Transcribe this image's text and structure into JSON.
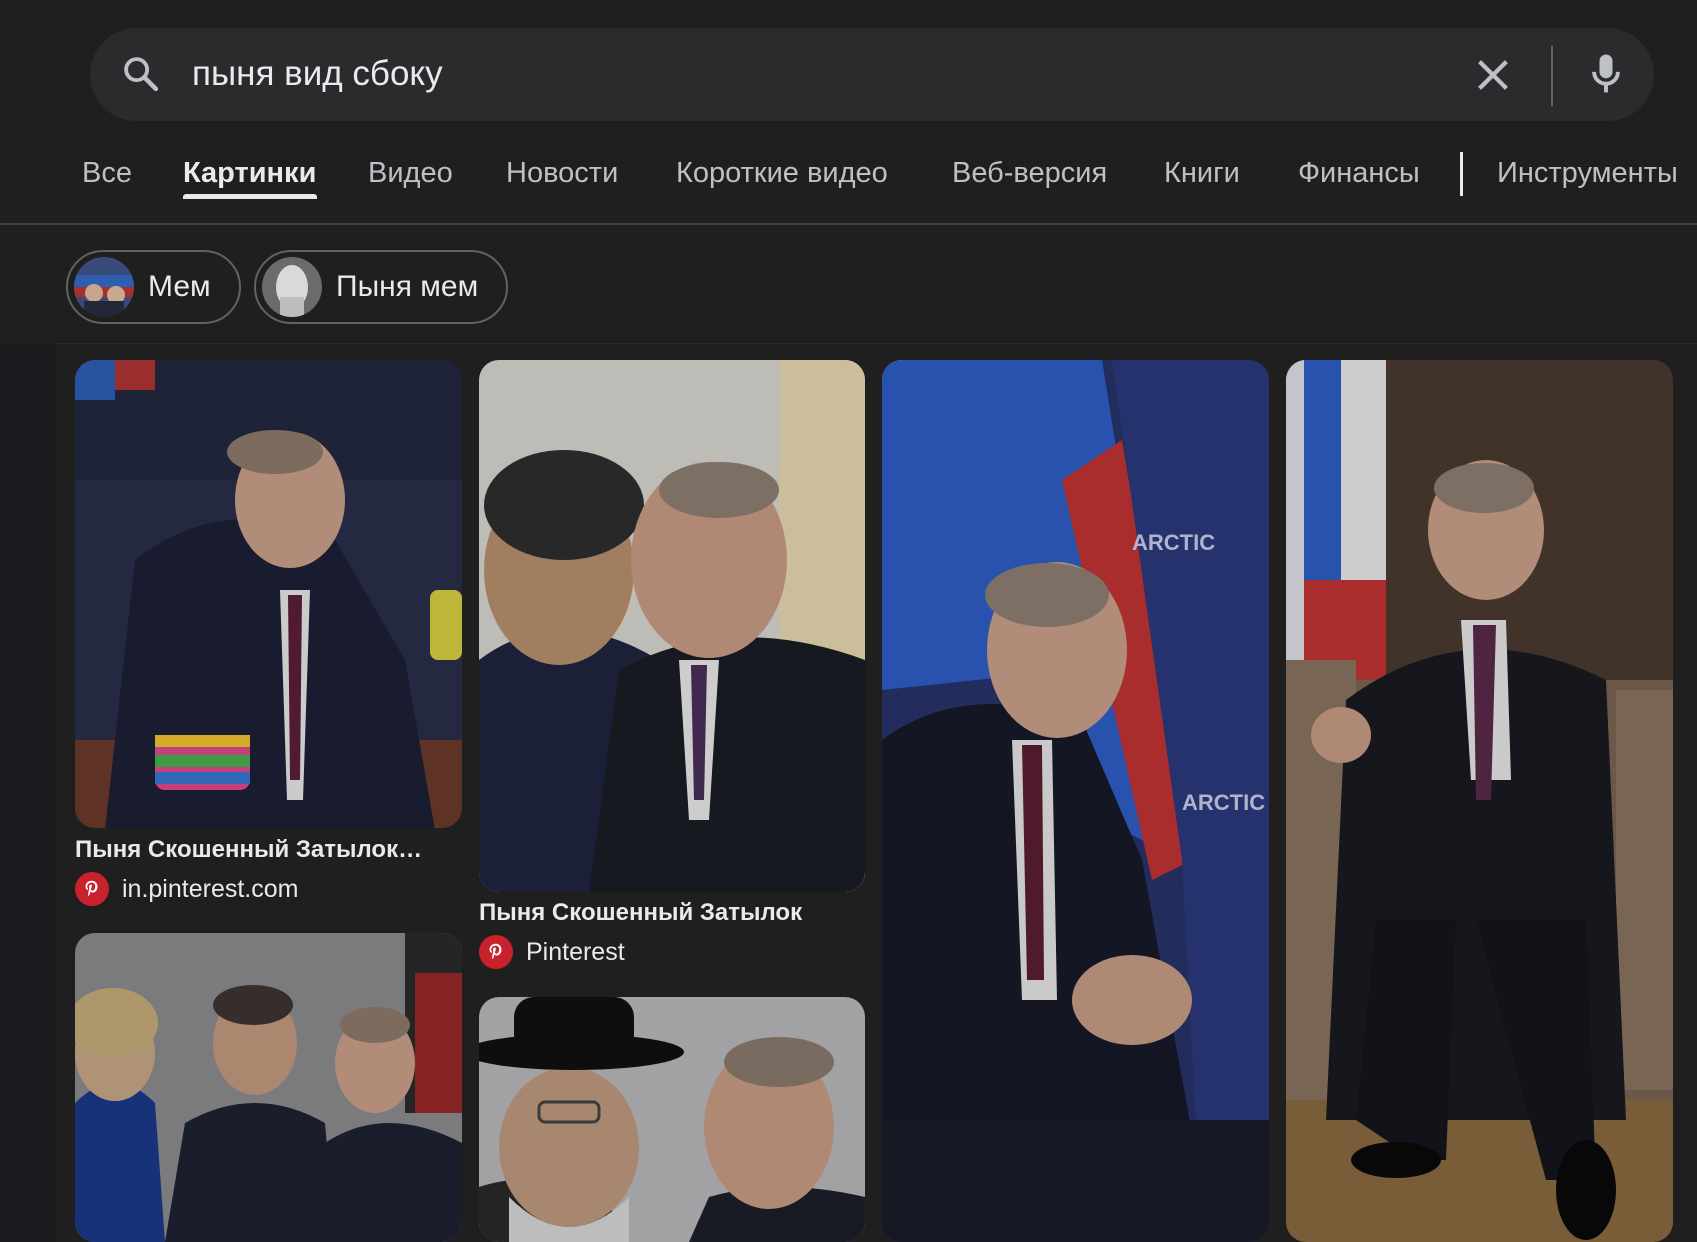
{
  "search": {
    "query": "пыня вид сбоку"
  },
  "tabs": [
    {
      "label": "Все",
      "active": false
    },
    {
      "label": "Картинки",
      "active": true
    },
    {
      "label": "Видео",
      "active": false
    },
    {
      "label": "Новости",
      "active": false
    },
    {
      "label": "Короткие видео",
      "active": false
    },
    {
      "label": "Веб-версия",
      "active": false
    },
    {
      "label": "Книги",
      "active": false
    },
    {
      "label": "Финансы",
      "active": false
    },
    {
      "label": "Инструменты",
      "active": false
    }
  ],
  "chips": [
    {
      "label": "Мем"
    },
    {
      "label": "Пыня мем"
    }
  ],
  "results": [
    {
      "title": "Пыня Скошенный Затылок…",
      "source": "in.pinterest.com",
      "source_icon": "pinterest-icon"
    },
    {
      "title": "Пыня Скошенный Затылок",
      "source": "Pinterest",
      "source_icon": "pinterest-icon"
    }
  ],
  "colors": {
    "background": "#1f1f1f",
    "searchbar": "#2b2b2d",
    "text": "#e8eaed",
    "muted_text": "#bdc1c6",
    "pinterest_red": "#c8232c"
  }
}
